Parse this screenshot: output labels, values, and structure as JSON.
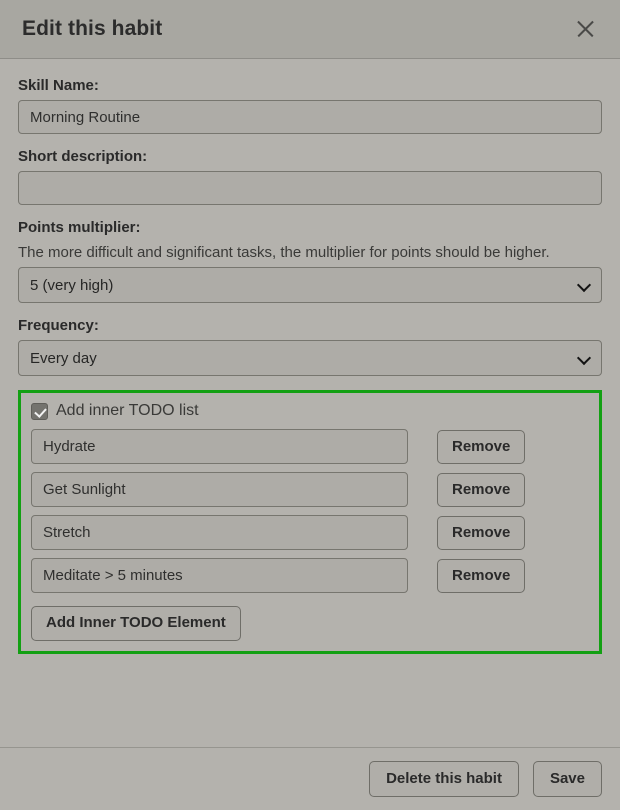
{
  "dialog": {
    "title": "Edit this habit",
    "close_icon": "close-icon"
  },
  "form": {
    "skill_name": {
      "label": "Skill Name:",
      "value": "Morning Routine",
      "placeholder": ""
    },
    "short_description": {
      "label": "Short description:",
      "value": "",
      "placeholder": ""
    },
    "points_multiplier": {
      "label": "Points multiplier:",
      "help": "The more difficult and significant tasks, the multiplier for points should be higher.",
      "selected": "5 (very high)"
    },
    "frequency": {
      "label": "Frequency:",
      "selected": "Every day"
    }
  },
  "todo_section": {
    "highlight_color": "#13a013",
    "checkbox": {
      "label": "Add inner TODO list",
      "checked": true
    },
    "items": [
      {
        "value": "Hydrate",
        "remove_label": "Remove"
      },
      {
        "value": "Get Sunlight",
        "remove_label": "Remove"
      },
      {
        "value": "Stretch",
        "remove_label": "Remove"
      },
      {
        "value": "Meditate > 5 minutes",
        "remove_label": "Remove"
      }
    ],
    "add_button_label": "Add Inner TODO Element"
  },
  "footer": {
    "delete_label": "Delete this habit",
    "save_label": "Save"
  }
}
